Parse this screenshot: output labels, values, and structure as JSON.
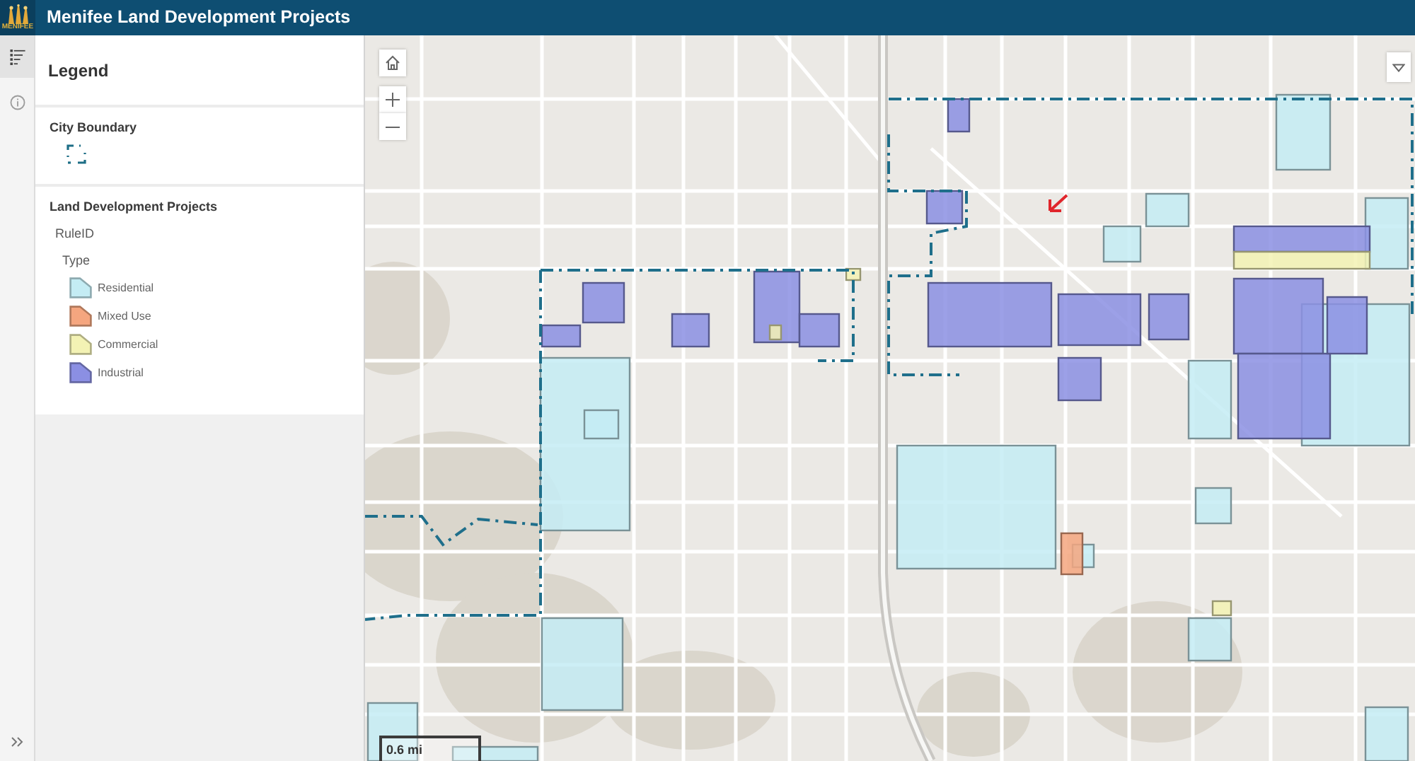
{
  "header": {
    "logo_text": "MENIFEE",
    "title": "Menifee Land Development Projects"
  },
  "rail": {
    "tabs": [
      {
        "kind": "legend",
        "selected": true
      },
      {
        "kind": "info",
        "selected": false
      }
    ]
  },
  "legend": {
    "title": "Legend",
    "layers": [
      {
        "kind": "boundary",
        "title": "City Boundary"
      },
      {
        "kind": "classes",
        "title": "Land Development Projects",
        "field": "RuleID",
        "group": "Type",
        "items": [
          {
            "label": "Residential",
            "color": "#c4ecf4"
          },
          {
            "label": "Mixed Use",
            "color": "#f5a67f"
          },
          {
            "label": "Commercial",
            "color": "#f3f2b4"
          },
          {
            "label": "Industrial",
            "color": "#8b8fe3"
          }
        ]
      }
    ]
  },
  "map": {
    "scale": "0.6 mi"
  }
}
